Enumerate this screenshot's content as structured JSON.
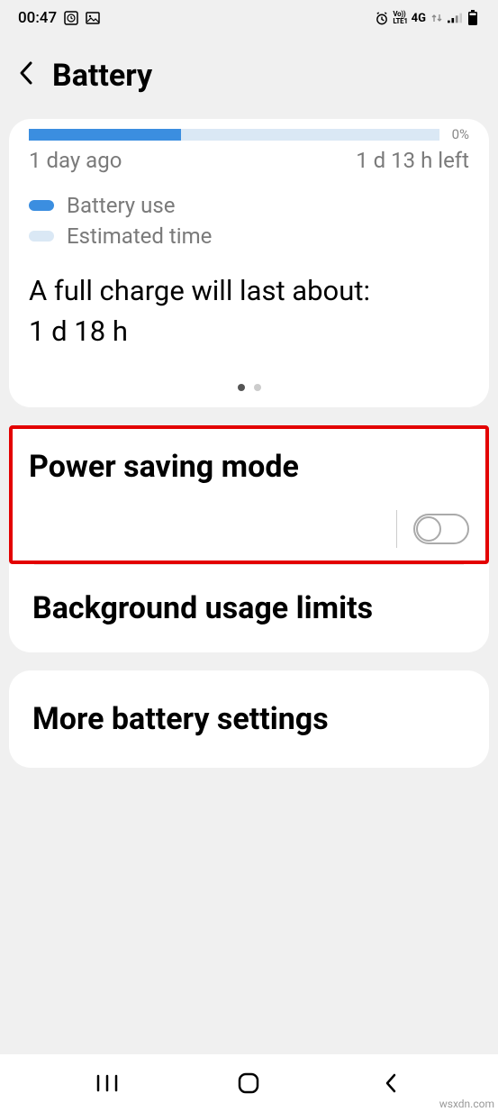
{
  "statusbar": {
    "time": "00:47",
    "icons_left": [
      "clock-square-icon",
      "image-icon"
    ],
    "icons_right": [
      "alarm-icon",
      "volte-icon",
      "4g-icon",
      "updown-icon",
      "signal-icon",
      "battery-icon"
    ]
  },
  "header": {
    "title": "Battery"
  },
  "battery": {
    "end_label": "0%",
    "left_time": "1 day ago",
    "right_time": "1 d 13 h left",
    "legend": {
      "use": "Battery use",
      "estimated": "Estimated time"
    },
    "full_charge_label": "A full charge will last about:",
    "full_charge_value": "1 d 18 h"
  },
  "settings": {
    "power_saving": "Power saving mode",
    "background_limits": "Background usage limits",
    "more_settings": "More battery settings"
  },
  "watermark": "wsxdn.com"
}
